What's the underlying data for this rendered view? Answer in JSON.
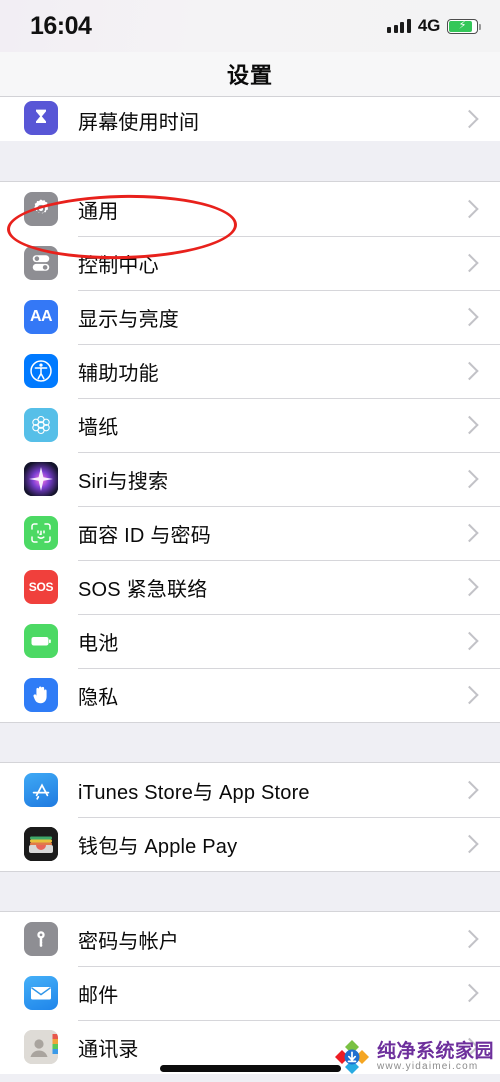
{
  "status_bar": {
    "time": "16:04",
    "network": "4G",
    "signal_icon": "signal-bars-icon",
    "battery_icon": "battery-charging-icon",
    "battery_level_percent": 80,
    "battery_color": "#34c759"
  },
  "header": {
    "title": "设置"
  },
  "annotation": {
    "type": "red-ellipse-highlight",
    "color": "#e8211c",
    "targets_row": "显示与亮度"
  },
  "sections": [
    {
      "id": "section-screentime",
      "clipped": true,
      "rows": [
        {
          "label": "屏幕使用时间",
          "icon": "hourglass-icon",
          "icon_class": "ic-screentime",
          "chevron": true
        }
      ]
    },
    {
      "id": "section-system",
      "rows": [
        {
          "label": "通用",
          "icon": "gear-icon",
          "icon_class": "ic-general",
          "chevron": true
        },
        {
          "label": "控制中心",
          "icon": "sliders-icon",
          "icon_class": "ic-control",
          "chevron": true
        },
        {
          "label": "显示与亮度",
          "icon": "aa-text-icon",
          "icon_class": "ic-display",
          "chevron": true,
          "highlighted": true
        },
        {
          "label": "辅助功能",
          "icon": "accessibility-icon",
          "icon_class": "ic-access",
          "chevron": true
        },
        {
          "label": "墙纸",
          "icon": "flower-icon",
          "icon_class": "ic-wallpaper",
          "chevron": true
        },
        {
          "label": "Siri与搜索",
          "icon": "siri-orb-icon",
          "icon_class": "ic-siri",
          "chevron": true
        },
        {
          "label": "面容 ID 与密码",
          "icon": "face-id-icon",
          "icon_class": "ic-faceid",
          "chevron": true
        },
        {
          "label": "SOS 紧急联络",
          "icon": "sos-icon",
          "icon_class": "ic-sos",
          "chevron": true
        },
        {
          "label": "电池",
          "icon": "battery-icon",
          "icon_class": "ic-battery",
          "chevron": true
        },
        {
          "label": "隐私",
          "icon": "hand-icon",
          "icon_class": "ic-privacy",
          "chevron": true
        }
      ]
    },
    {
      "id": "section-stores",
      "rows": [
        {
          "label": "iTunes Store与 App Store",
          "icon": "app-store-icon",
          "icon_class": "ic-appstore",
          "chevron": true
        },
        {
          "label": "钱包与 Apple Pay",
          "icon": "wallet-icon",
          "icon_class": "ic-wallet",
          "chevron": true
        }
      ]
    },
    {
      "id": "section-accounts",
      "rows": [
        {
          "label": "密码与帐户",
          "icon": "key-icon",
          "icon_class": "ic-passwords",
          "chevron": true
        },
        {
          "label": "邮件",
          "icon": "mail-icon",
          "icon_class": "ic-mail",
          "chevron": true
        },
        {
          "label": "通讯录",
          "icon": "contacts-icon",
          "icon_class": "ic-contacts",
          "chevron": true
        }
      ]
    }
  ],
  "watermark": {
    "name": "纯净系统家园",
    "url": "www.yidaimei.com",
    "name_color": "#6d2f9c"
  },
  "home_indicator": {
    "visible": true
  }
}
